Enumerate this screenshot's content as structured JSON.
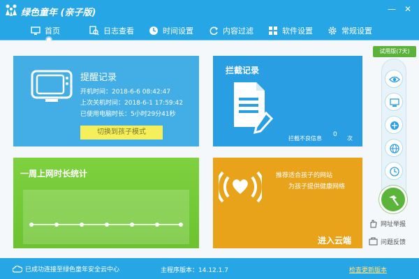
{
  "window": {
    "title": "绿色童年 (亲子版)",
    "controls": [
      "minimize",
      "close"
    ]
  },
  "nav": {
    "items": [
      {
        "label": "首页",
        "icon": "monitor-icon"
      },
      {
        "label": "日志查看",
        "icon": "search-doc-icon"
      },
      {
        "label": "时间设置",
        "icon": "clock-icon"
      },
      {
        "label": "内容过滤",
        "icon": "refresh-icon"
      },
      {
        "label": "软件设置",
        "icon": "grid-icon"
      },
      {
        "label": "常规设置",
        "icon": "gear-icon"
      }
    ],
    "active_index": 0
  },
  "reminder": {
    "title": "提醒记录",
    "boot_time": "开机时间：2018-6-6 08:42:47",
    "last_shutdown": "上次关机时间：2018-6-1 17:59:42",
    "used_time": "已使用电脑时长：5小时29分41秒",
    "switch_button": "切换到孩子模式"
  },
  "intercept": {
    "title": "拦截记录",
    "label": "拦截不良信息",
    "count": "0",
    "unit": "次"
  },
  "weekly": {
    "title": "一周上网时长统计"
  },
  "cloud": {
    "line1": "推荐适合孩子的网站",
    "line2": "为孩子提供健康网络",
    "enter": "进入云端"
  },
  "sidebar": {
    "badge": "试用版(7天)",
    "icons": [
      "eye-icon",
      "screen-icon",
      "network-icon",
      "globe-icon",
      "clock-icon"
    ],
    "report": "网址举报",
    "feedback": "问题反馈"
  },
  "status": {
    "connected": "已成功连接至绿色童年安全云中心",
    "version": "主程序版本：14.12.1.7",
    "update": "检查更新版本"
  },
  "colors": {
    "primary": "#27a6e6",
    "reminder": "#42aee5",
    "intercept": "#2a9ee3",
    "weekly": "#7ed13f",
    "cloud": "#e8a31b",
    "switch": "#f6ef5c"
  }
}
